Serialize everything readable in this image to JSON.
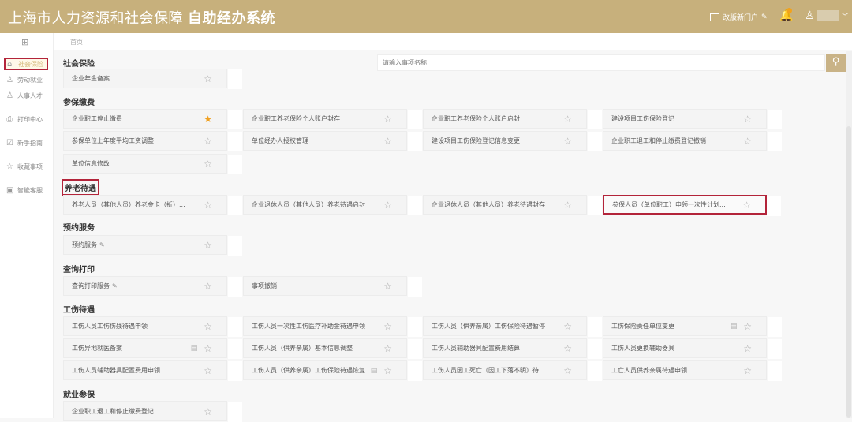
{
  "header": {
    "title_light": "上海市人力资源和社会保障",
    "title_bold": "自助经办系统",
    "portal_label": "改版新门户",
    "link_icon": "🔗"
  },
  "sidebar": {
    "items": [
      {
        "label": "社会保险",
        "icon": "⌂",
        "active": true
      },
      {
        "label": "劳动就业",
        "icon": "♙"
      },
      {
        "label": "人事人才",
        "icon": "♙"
      },
      {
        "label": "打印中心",
        "icon": "⎙"
      },
      {
        "label": "新手指南",
        "icon": "☑"
      },
      {
        "label": "收藏事项",
        "icon": "☆"
      },
      {
        "label": "智能客服",
        "icon": "▣"
      }
    ]
  },
  "breadcrumb": "首页",
  "search": {
    "placeholder": "请输入事项名称"
  },
  "sections": [
    {
      "title": "社会保险",
      "rows": [
        [
          {
            "label": "企业年金备案"
          }
        ]
      ]
    },
    {
      "title": "参保缴费",
      "rows": [
        [
          {
            "label": "企业职工停止缴费",
            "starred": true
          },
          {
            "label": "企业职工养老保险个人账户封存"
          },
          {
            "label": "企业职工养老保险个人账户启封"
          },
          {
            "label": "建设项目工伤保险登记"
          }
        ],
        [
          {
            "label": "参保单位上年度平均工资调整"
          },
          {
            "label": "单位经办人授权管理"
          },
          {
            "label": "建设项目工伤保险登记信息变更"
          },
          {
            "label": "企业职工退工和停止缴费登记撤销"
          }
        ],
        [
          {
            "label": "单位信息修改"
          }
        ]
      ]
    },
    {
      "title": "养老待遇",
      "highlighted": true,
      "rows": [
        [
          {
            "label": "养老人员（其他人员）养老金卡（折）..."
          },
          {
            "label": "企业退休人员（其他人员）养老待遇启封"
          },
          {
            "label": "企业退休人员（其他人员）养老待遇封存"
          },
          {
            "label": "参保人员（单位职工）申领一次性计划...",
            "highlighted": true
          }
        ]
      ]
    },
    {
      "title": "预约服务",
      "rows": [
        [
          {
            "label": "预约服务",
            "link": true
          }
        ]
      ]
    },
    {
      "title": "查询打印",
      "rows": [
        [
          {
            "label": "查询打印服务",
            "link": true
          },
          {
            "label": "事项撤销"
          }
        ]
      ]
    },
    {
      "title": "工伤待遇",
      "rows": [
        [
          {
            "label": "工伤人员工伤伤残待遇申领"
          },
          {
            "label": "工伤人员一次性工伤医疗补助金待遇申领"
          },
          {
            "label": "工伤人员（供养亲属）工伤保险待遇暂停"
          },
          {
            "label": "工伤保险责任单位变更",
            "doc": true
          }
        ],
        [
          {
            "label": "工伤异地就医备案",
            "doc": true
          },
          {
            "label": "工伤人员（供养亲属）基本信息调整"
          },
          {
            "label": "工伤人员辅助器具配置费用结算"
          },
          {
            "label": "工伤人员更换辅助器具"
          }
        ],
        [
          {
            "label": "工伤人员辅助器具配置费用申领"
          },
          {
            "label": "工伤人员（供养亲属）工伤保险待遇恢复",
            "doc": true
          },
          {
            "label": "工伤人员因工死亡（因工下落不明）待..."
          },
          {
            "label": "工亡人员供养亲属待遇申领"
          }
        ]
      ]
    },
    {
      "title": "就业参保",
      "rows": [
        [
          {
            "label": "企业职工退工和停止缴费登记"
          }
        ]
      ]
    }
  ]
}
